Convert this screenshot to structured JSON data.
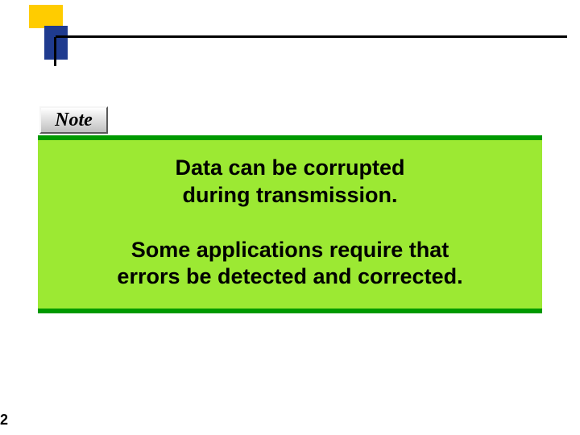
{
  "note_label": "Note",
  "body": {
    "l1": "Data can be corrupted",
    "l2": "during transmission.",
    "l3": "Some applications require that",
    "l4": "errors be detected and corrected."
  },
  "page_number": "2"
}
